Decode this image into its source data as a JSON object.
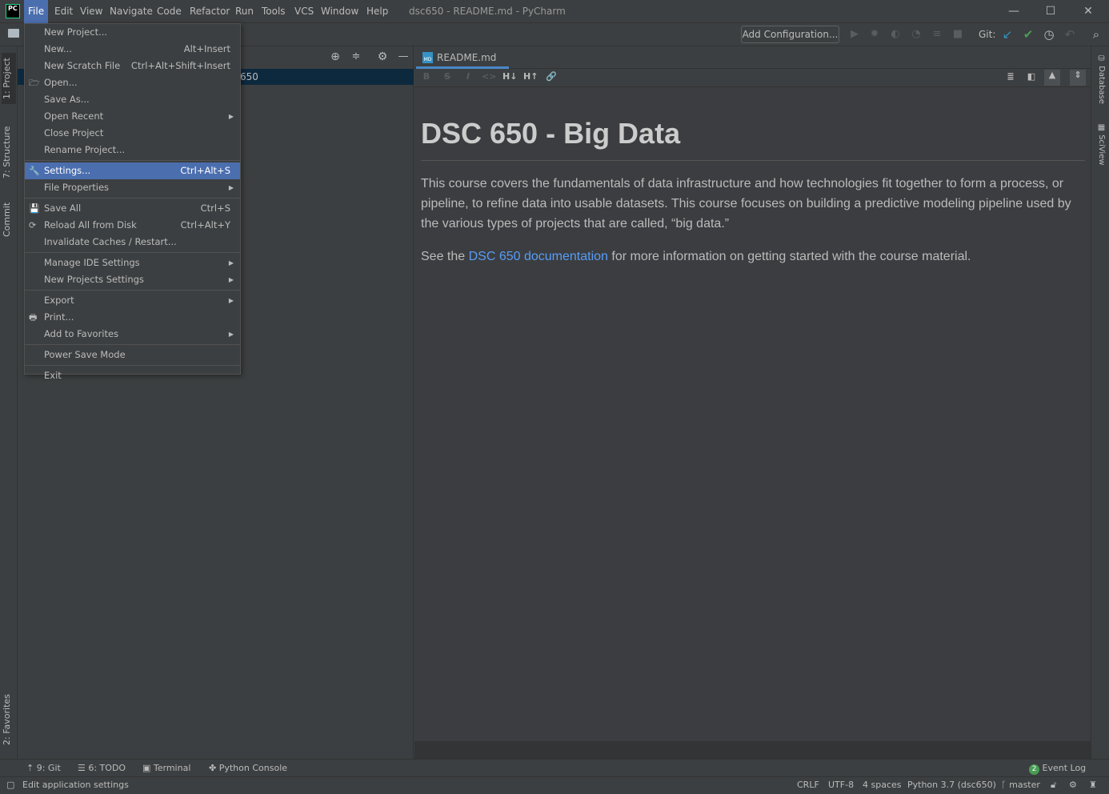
{
  "title_bar": {
    "logo": "PC",
    "menus": [
      "File",
      "Edit",
      "View",
      "Navigate",
      "Code",
      "Refactor",
      "Run",
      "Tools",
      "VCS",
      "Window",
      "Help"
    ],
    "window_title": "dsc650 - README.md - PyCharm",
    "controls": [
      "minimize-icon",
      "maximize-icon",
      "close-icon"
    ]
  },
  "nav_bar": {
    "add_configuration": "Add Configuration...",
    "git_label": "Git:"
  },
  "left_stripe": {
    "tabs": [
      "1: Project",
      "7: Structure",
      "Commit",
      "2: Favorites"
    ]
  },
  "project_panel": {
    "selected_row": "650"
  },
  "editor": {
    "tab": "README.md",
    "tab_icon": "MD",
    "md_toolbar": [
      "B",
      "S",
      "I",
      "<>",
      "H↓",
      "H↑",
      "link"
    ]
  },
  "preview": {
    "heading": "DSC 650 - Big Data",
    "paragraph1": "This course covers the fundamentals of data infrastructure and how technologies fit together to form a process, or pipeline, to refine data into usable datasets. This course focuses on building a predictive modeling pipeline used by the various types of projects that are called, “big data.”",
    "p2_before": "See the ",
    "p2_link": "DSC 650 documentation",
    "p2_after": " for more information on getting started with the course material."
  },
  "right_stripe": {
    "tabs": [
      "Database",
      "SciView"
    ]
  },
  "file_menu": [
    {
      "label": "New Project..."
    },
    {
      "label": "New...",
      "shortcut": "Alt+Insert"
    },
    {
      "label": "New Scratch File",
      "shortcut": "Ctrl+Alt+Shift+Insert"
    },
    {
      "label": "Open...",
      "icon": "folder-icon"
    },
    {
      "label": "Save As..."
    },
    {
      "label": "Open Recent",
      "submenu": true
    },
    {
      "label": "Close Project"
    },
    {
      "label": "Rename Project..."
    },
    {
      "sep": true
    },
    {
      "label": "Settings...",
      "shortcut": "Ctrl+Alt+S",
      "icon": "wrench-icon",
      "selected": true
    },
    {
      "label": "File Properties",
      "submenu": true
    },
    {
      "sep": true
    },
    {
      "label": "Save All",
      "shortcut": "Ctrl+S",
      "icon": "save-icon"
    },
    {
      "label": "Reload All from Disk",
      "shortcut": "Ctrl+Alt+Y",
      "icon": "reload-icon"
    },
    {
      "label": "Invalidate Caches / Restart..."
    },
    {
      "sep": true
    },
    {
      "label": "Manage IDE Settings",
      "submenu": true
    },
    {
      "label": "New Projects Settings",
      "submenu": true
    },
    {
      "sep": true
    },
    {
      "label": "Export",
      "submenu": true
    },
    {
      "label": "Print...",
      "icon": "print-icon"
    },
    {
      "label": "Add to Favorites",
      "submenu": true
    },
    {
      "sep": true
    },
    {
      "label": "Power Save Mode"
    },
    {
      "sep": true
    },
    {
      "label": "Exit"
    }
  ],
  "tool_windows": [
    "9: Git",
    "6: TODO",
    "Terminal",
    "Python Console"
  ],
  "event_log": {
    "count": "2",
    "label": "Event Log"
  },
  "status_bar": {
    "message": "Edit application settings",
    "line_sep": "CRLF",
    "encoding": "UTF-8",
    "indent": "4 spaces",
    "interpreter": "Python 3.7 (dsc650)",
    "branch": "master"
  },
  "colors": {
    "accent": "#4b6eaf",
    "link": "#589df6",
    "git_update": "#3592c4",
    "git_commit": "#499c54"
  }
}
